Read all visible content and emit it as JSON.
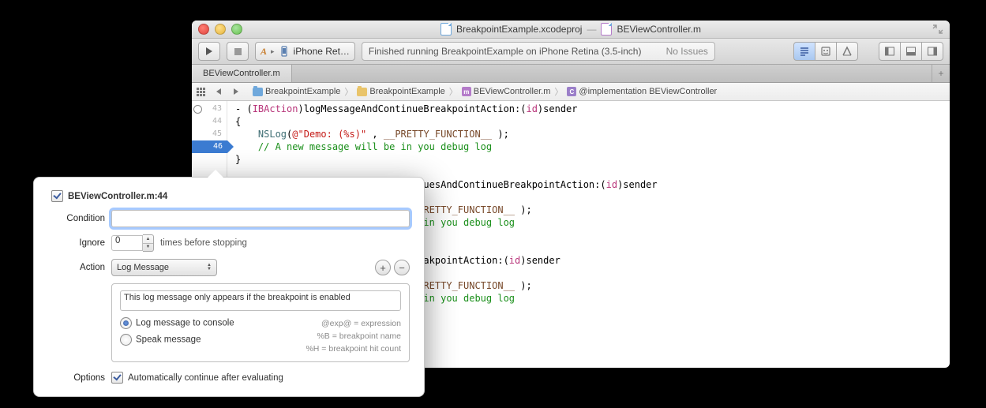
{
  "title": {
    "project": "BreakpointExample.xcodeproj",
    "file": "BEViewController.m"
  },
  "toolbar": {
    "scheme_target": "iPhone Ret…",
    "activity": "Finished running BreakpointExample on iPhone Retina (3.5-inch)",
    "status": "No Issues"
  },
  "tab": {
    "label": "BEViewController.m"
  },
  "jump": {
    "seg1": "BreakpointExample",
    "seg2": "BreakpointExample",
    "seg3": "BEViewController.m",
    "seg4": "@implementation BEViewController"
  },
  "gutter": {
    "l43": "43",
    "l44": "44",
    "l45": "45",
    "l46": "46"
  },
  "code": {
    "l1a": "- (",
    "l1b": "IBAction",
    "l1c": ")logMessageAndContinueBreakpointAction:(",
    "l1d": "id",
    "l1e": ")sender",
    "brace_open": "{",
    "brace_close": "}",
    "nslog_a": "    ",
    "nslog_b": "NSLog",
    "nslog_c": "(",
    "nslog_d": "@\"Demo: (%s)\"",
    "nslog_e": " , ",
    "nslog_f": "__PRETTY_FUNCTION__",
    "nslog_g": " );",
    "comment": "    // A new message will be in you debug log",
    "l2a": "thValuesAndContinueBreakpointAction:(",
    "l2b": "id",
    "l2c": ")sender",
    "frag_a": ", ",
    "frag_b": "__PRETTY_FUNCTION__",
    "frag_c": " );",
    "frag_comment": "l be in you debug log",
    "l3a": "onBreakpointAction:(",
    "l3b": "id",
    "l3c": ")sender"
  },
  "popover": {
    "title": "BEViewController.m:44",
    "condition_label": "Condition",
    "ignore_label": "Ignore",
    "ignore_value": "0",
    "ignore_suffix": "times before stopping",
    "action_label": "Action",
    "action_value": "Log Message",
    "log_placeholder": "This log message only appears if the breakpoint is enabled",
    "radio_console": "Log message to console",
    "radio_speak": "Speak message",
    "hint1": "@exp@ = expression",
    "hint2": "%B = breakpoint name",
    "hint3": "%H = breakpoint hit count",
    "options_label": "Options",
    "options_check": "Automatically continue after evaluating"
  }
}
